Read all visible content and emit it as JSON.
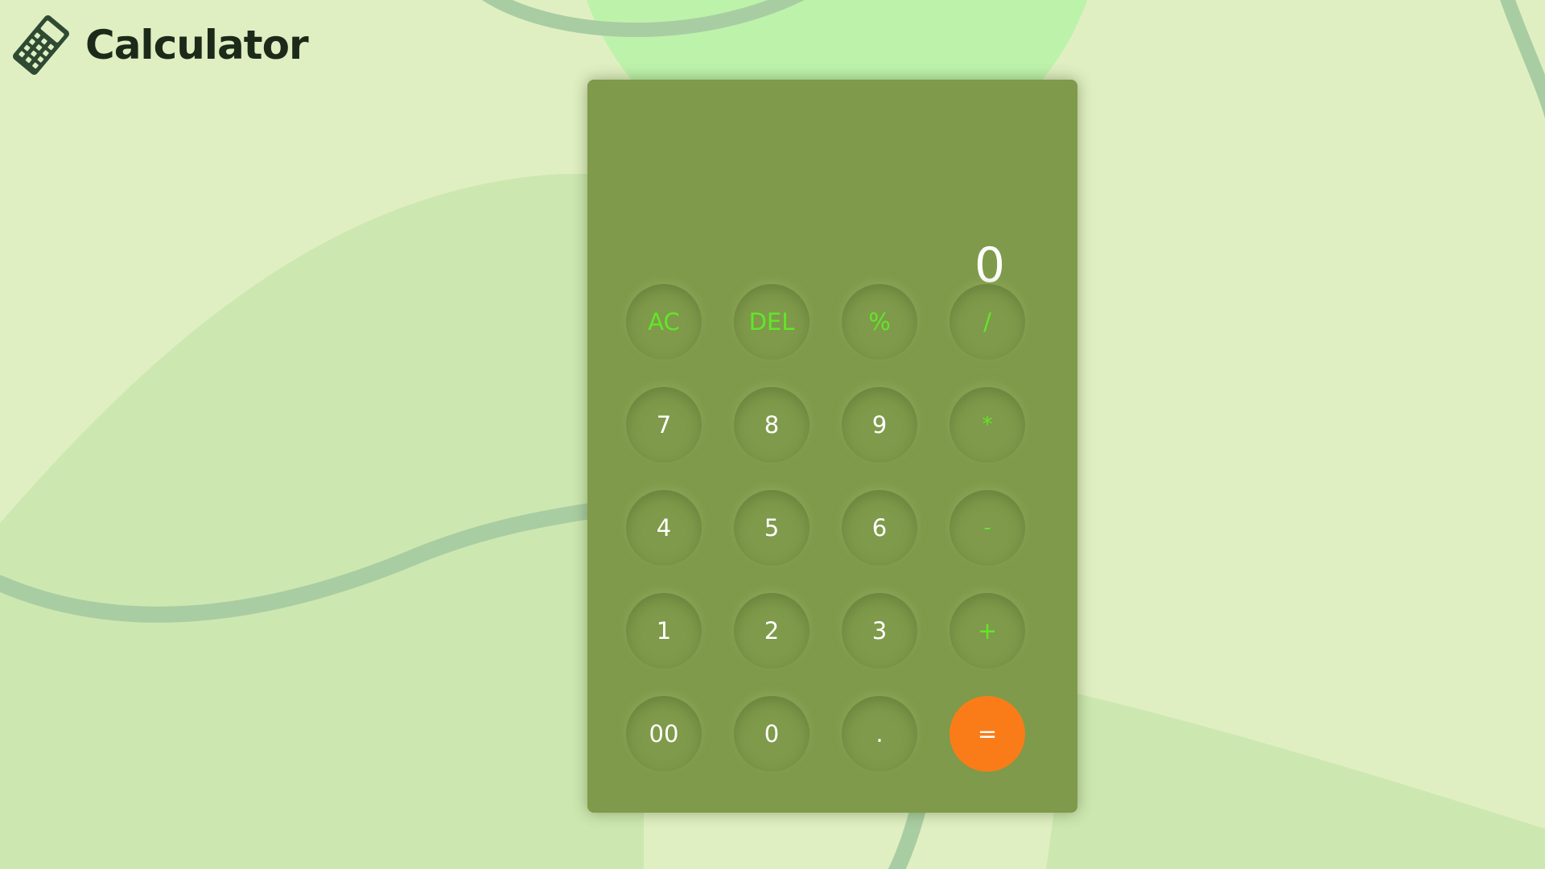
{
  "app": {
    "title": "Calculator",
    "logo_icon": "calculator-icon"
  },
  "display": {
    "value": "0"
  },
  "colors": {
    "background": "#e0efc2",
    "panel": "#7f9a4a",
    "operator_text": "#62e62a",
    "digit_text": "#ffffff",
    "equals_button": "#fa7c18"
  },
  "keypad": {
    "rows": [
      [
        {
          "label": "AC",
          "name": "all-clear-button",
          "kind": "op"
        },
        {
          "label": "DEL",
          "name": "delete-button",
          "kind": "op"
        },
        {
          "label": "%",
          "name": "percent-button",
          "kind": "op"
        },
        {
          "label": "/",
          "name": "divide-button",
          "kind": "op"
        }
      ],
      [
        {
          "label": "7",
          "name": "digit-7-button",
          "kind": "digit"
        },
        {
          "label": "8",
          "name": "digit-8-button",
          "kind": "digit"
        },
        {
          "label": "9",
          "name": "digit-9-button",
          "kind": "digit"
        },
        {
          "label": "*",
          "name": "multiply-button",
          "kind": "op"
        }
      ],
      [
        {
          "label": "4",
          "name": "digit-4-button",
          "kind": "digit"
        },
        {
          "label": "5",
          "name": "digit-5-button",
          "kind": "digit"
        },
        {
          "label": "6",
          "name": "digit-6-button",
          "kind": "digit"
        },
        {
          "label": "-",
          "name": "subtract-button",
          "kind": "op"
        }
      ],
      [
        {
          "label": "1",
          "name": "digit-1-button",
          "kind": "digit"
        },
        {
          "label": "2",
          "name": "digit-2-button",
          "kind": "digit"
        },
        {
          "label": "3",
          "name": "digit-3-button",
          "kind": "digit"
        },
        {
          "label": "+",
          "name": "add-button",
          "kind": "op"
        }
      ],
      [
        {
          "label": "00",
          "name": "double-zero-button",
          "kind": "digit"
        },
        {
          "label": "0",
          "name": "digit-0-button",
          "kind": "digit"
        },
        {
          "label": ".",
          "name": "decimal-point-button",
          "kind": "digit"
        },
        {
          "label": "=",
          "name": "equals-button",
          "kind": "equals"
        }
      ]
    ]
  }
}
